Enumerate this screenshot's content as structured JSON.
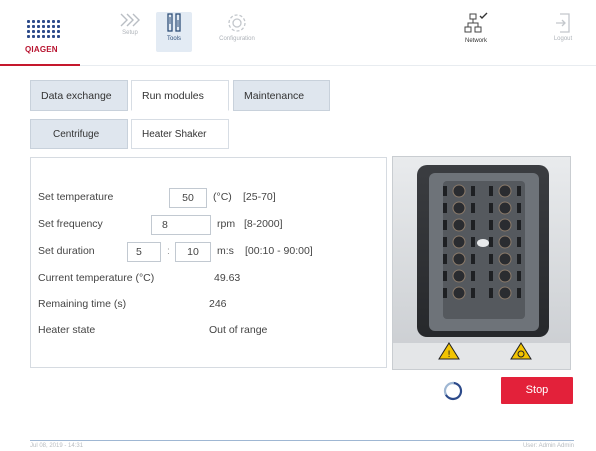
{
  "brand": {
    "logo_text": "QIAGEN"
  },
  "nav": {
    "setup": "Setup",
    "tools": "Tools",
    "configuration": "Configuration",
    "network": "Network",
    "logout": "Logout"
  },
  "tabs": [
    "Data exchange",
    "Run modules",
    "Maintenance"
  ],
  "subtabs": [
    "Centrifuge",
    "Heater Shaker"
  ],
  "form": {
    "set_temperature": {
      "label": "Set temperature",
      "value": "50",
      "unit": "(°C)",
      "range": "[25-70]"
    },
    "set_frequency": {
      "label": "Set frequency",
      "value": "8",
      "unit": "rpm",
      "range": "[8-2000]"
    },
    "set_duration": {
      "label": "Set duration",
      "minutes": "5",
      "separator": ":",
      "seconds": "10",
      "unit": "m:s",
      "range": "[00:10 - 90:00]"
    },
    "current_temperature": {
      "label": "Current temperature (°C)",
      "value": "49.63"
    },
    "remaining_time": {
      "label": "Remaining time (s)",
      "value": "246"
    },
    "heater_state": {
      "label": "Heater state",
      "value": "Out of range"
    }
  },
  "actions": {
    "stop": "Stop"
  },
  "footer": {
    "left": "Jul 08, 2019 - 14:31",
    "right": "User: Admin Admin"
  },
  "colors": {
    "accent_red": "#e3213a",
    "brand_blue": "#2c4a8a",
    "tab_bg": "#dfe6ee"
  }
}
